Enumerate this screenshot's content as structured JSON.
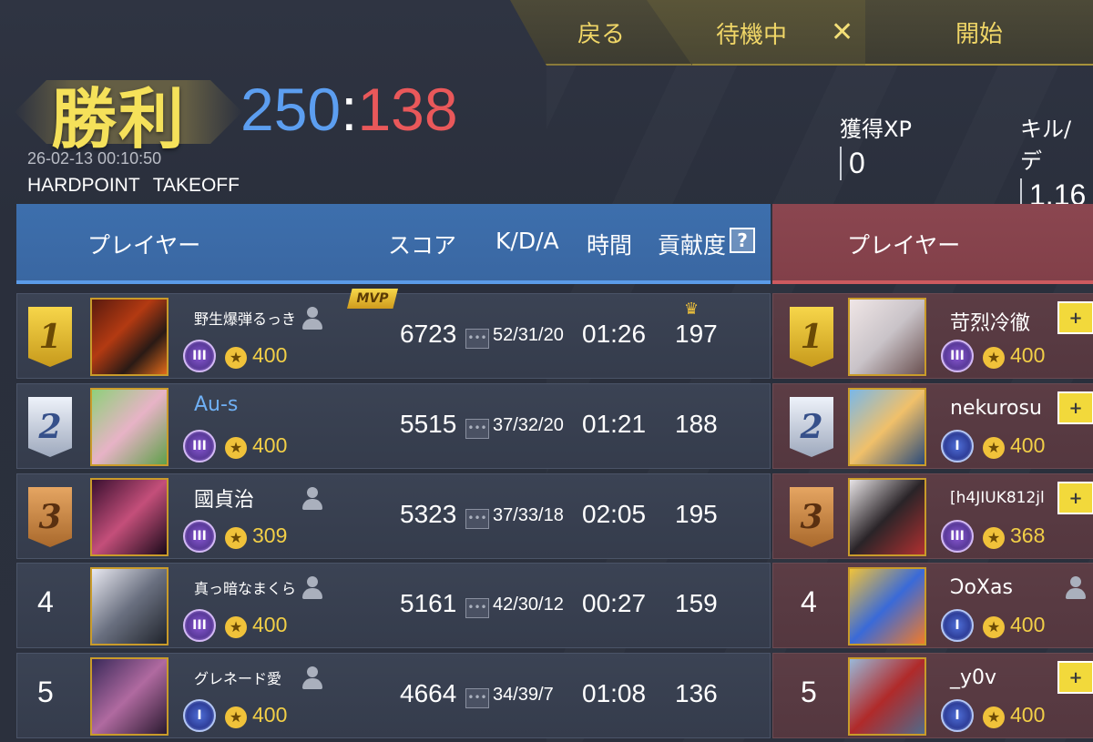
{
  "topbar": {
    "back_label": "戻る",
    "wait_label": "待機中",
    "close_symbol": "✕",
    "start_label": "開始"
  },
  "header": {
    "result": "勝利",
    "score_blue": "250",
    "score_sep": ":",
    "score_red": "138",
    "datetime": "26-02-13 00:10:50",
    "mode": "HARDPOINT",
    "map": "TAKEOFF",
    "xp_label": "獲得XP",
    "xp_value": "0",
    "kd_label": "キル/デ",
    "kd_value": "1.16"
  },
  "columns": {
    "player": "プレイヤー",
    "score": "スコア",
    "kda": "K/D/A",
    "time": "時間",
    "contribution": "貢献度",
    "help": "?",
    "player_right": "プレイヤー"
  },
  "colors": {
    "blue_team": "#5c9ef0",
    "red_team": "#e9585a",
    "gold": "#f2cf47"
  },
  "blue_team": [
    {
      "rank": "1",
      "name": "野生爆弾るっき",
      "level": "400",
      "score": "6723",
      "kda": "52/31/20",
      "time": "01:26",
      "contribution": "197",
      "mvp": "MVP",
      "rank_icon": "III"
    },
    {
      "rank": "2",
      "name": "Au-s",
      "level": "400",
      "score": "5515",
      "kda": "37/32/20",
      "time": "01:21",
      "contribution": "188",
      "rank_icon": "III"
    },
    {
      "rank": "3",
      "name": "國貞治",
      "level": "309",
      "score": "5323",
      "kda": "37/33/18",
      "time": "02:05",
      "contribution": "195",
      "rank_icon": "III"
    },
    {
      "rank": "4",
      "name": "真っ暗なまくら",
      "level": "400",
      "score": "5161",
      "kda": "42/30/12",
      "time": "00:27",
      "contribution": "159",
      "rank_icon": "III"
    },
    {
      "rank": "5",
      "name": "グレネード愛",
      "level": "400",
      "score": "4664",
      "kda": "34/39/7",
      "time": "01:08",
      "contribution": "136",
      "rank_icon": "I"
    }
  ],
  "red_team": [
    {
      "rank": "1",
      "name": "苛烈冷徹",
      "level": "400",
      "rank_icon": "III"
    },
    {
      "rank": "2",
      "name": "nekurosu",
      "level": "400",
      "rank_icon": "I"
    },
    {
      "rank": "3",
      "name": "[h4JIUK812jl",
      "level": "368",
      "rank_icon": "III"
    },
    {
      "rank": "4",
      "name": "ƆoXas",
      "level": "400",
      "rank_icon": "I"
    },
    {
      "rank": "5",
      "name": "_y0v",
      "level": "400",
      "rank_icon": "I"
    }
  ],
  "icons": {
    "star": "★",
    "kda": "•••",
    "crown": "♛",
    "add_friend": "+"
  }
}
